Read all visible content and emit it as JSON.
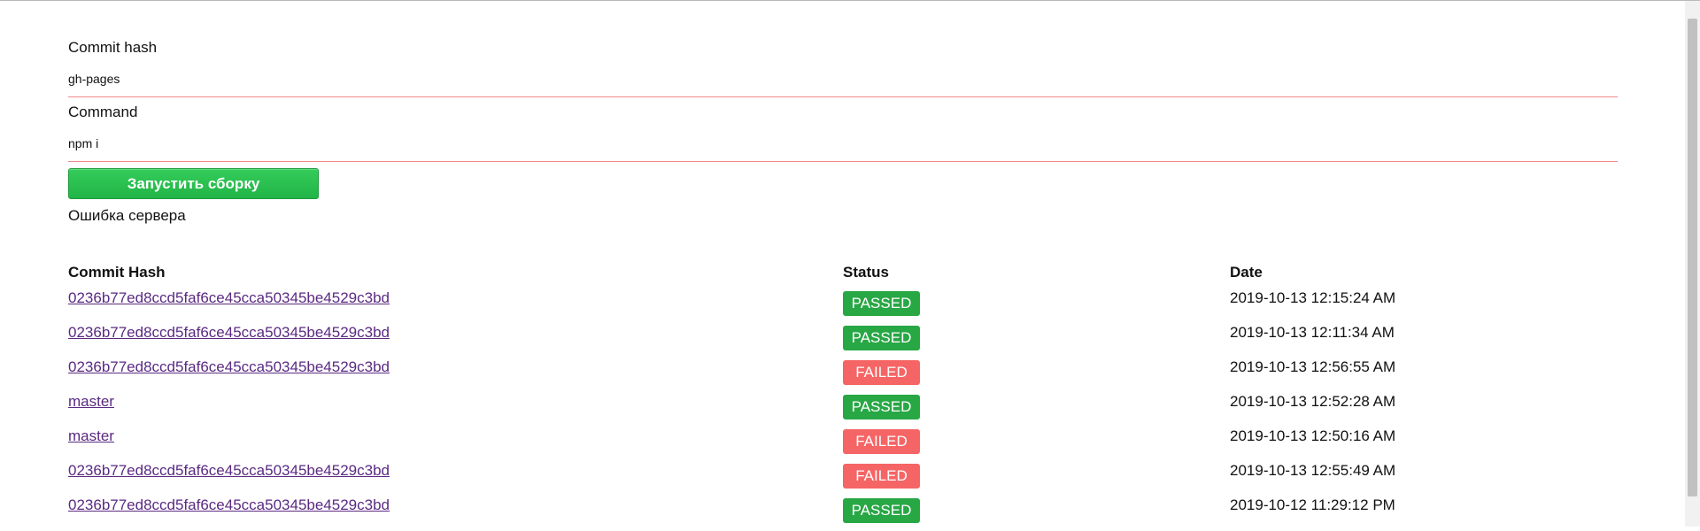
{
  "form": {
    "commit_label": "Commit hash",
    "commit_value": "gh-pages",
    "command_label": "Command",
    "command_value": "npm i",
    "run_button_label": "Запустить сборку",
    "error_message": "Ошибка сервера"
  },
  "table": {
    "headers": {
      "hash": "Commit Hash",
      "status": "Status",
      "date": "Date"
    },
    "rows": [
      {
        "hash": "0236b77ed8ccd5faf6ce45cca50345be4529c3bd",
        "status": "PASSED",
        "date": "2019-10-13 12:15:24 AM"
      },
      {
        "hash": "0236b77ed8ccd5faf6ce45cca50345be4529c3bd",
        "status": "PASSED",
        "date": "2019-10-13 12:11:34 AM"
      },
      {
        "hash": "0236b77ed8ccd5faf6ce45cca50345be4529c3bd",
        "status": "FAILED",
        "date": "2019-10-13 12:56:55 AM"
      },
      {
        "hash": "master",
        "status": "PASSED",
        "date": "2019-10-13 12:52:28 AM"
      },
      {
        "hash": "master",
        "status": "FAILED",
        "date": "2019-10-13 12:50:16 AM"
      },
      {
        "hash": "0236b77ed8ccd5faf6ce45cca50345be4529c3bd",
        "status": "FAILED",
        "date": "2019-10-13 12:55:49 AM"
      },
      {
        "hash": "0236b77ed8ccd5faf6ce45cca50345be4529c3bd",
        "status": "PASSED",
        "date": "2019-10-12 11:29:12 PM"
      }
    ]
  },
  "colors": {
    "passed": "#28a745",
    "failed": "#f56565",
    "link": "#5a2a82",
    "input_underline": "#f08a8a",
    "button": "#22b447"
  }
}
